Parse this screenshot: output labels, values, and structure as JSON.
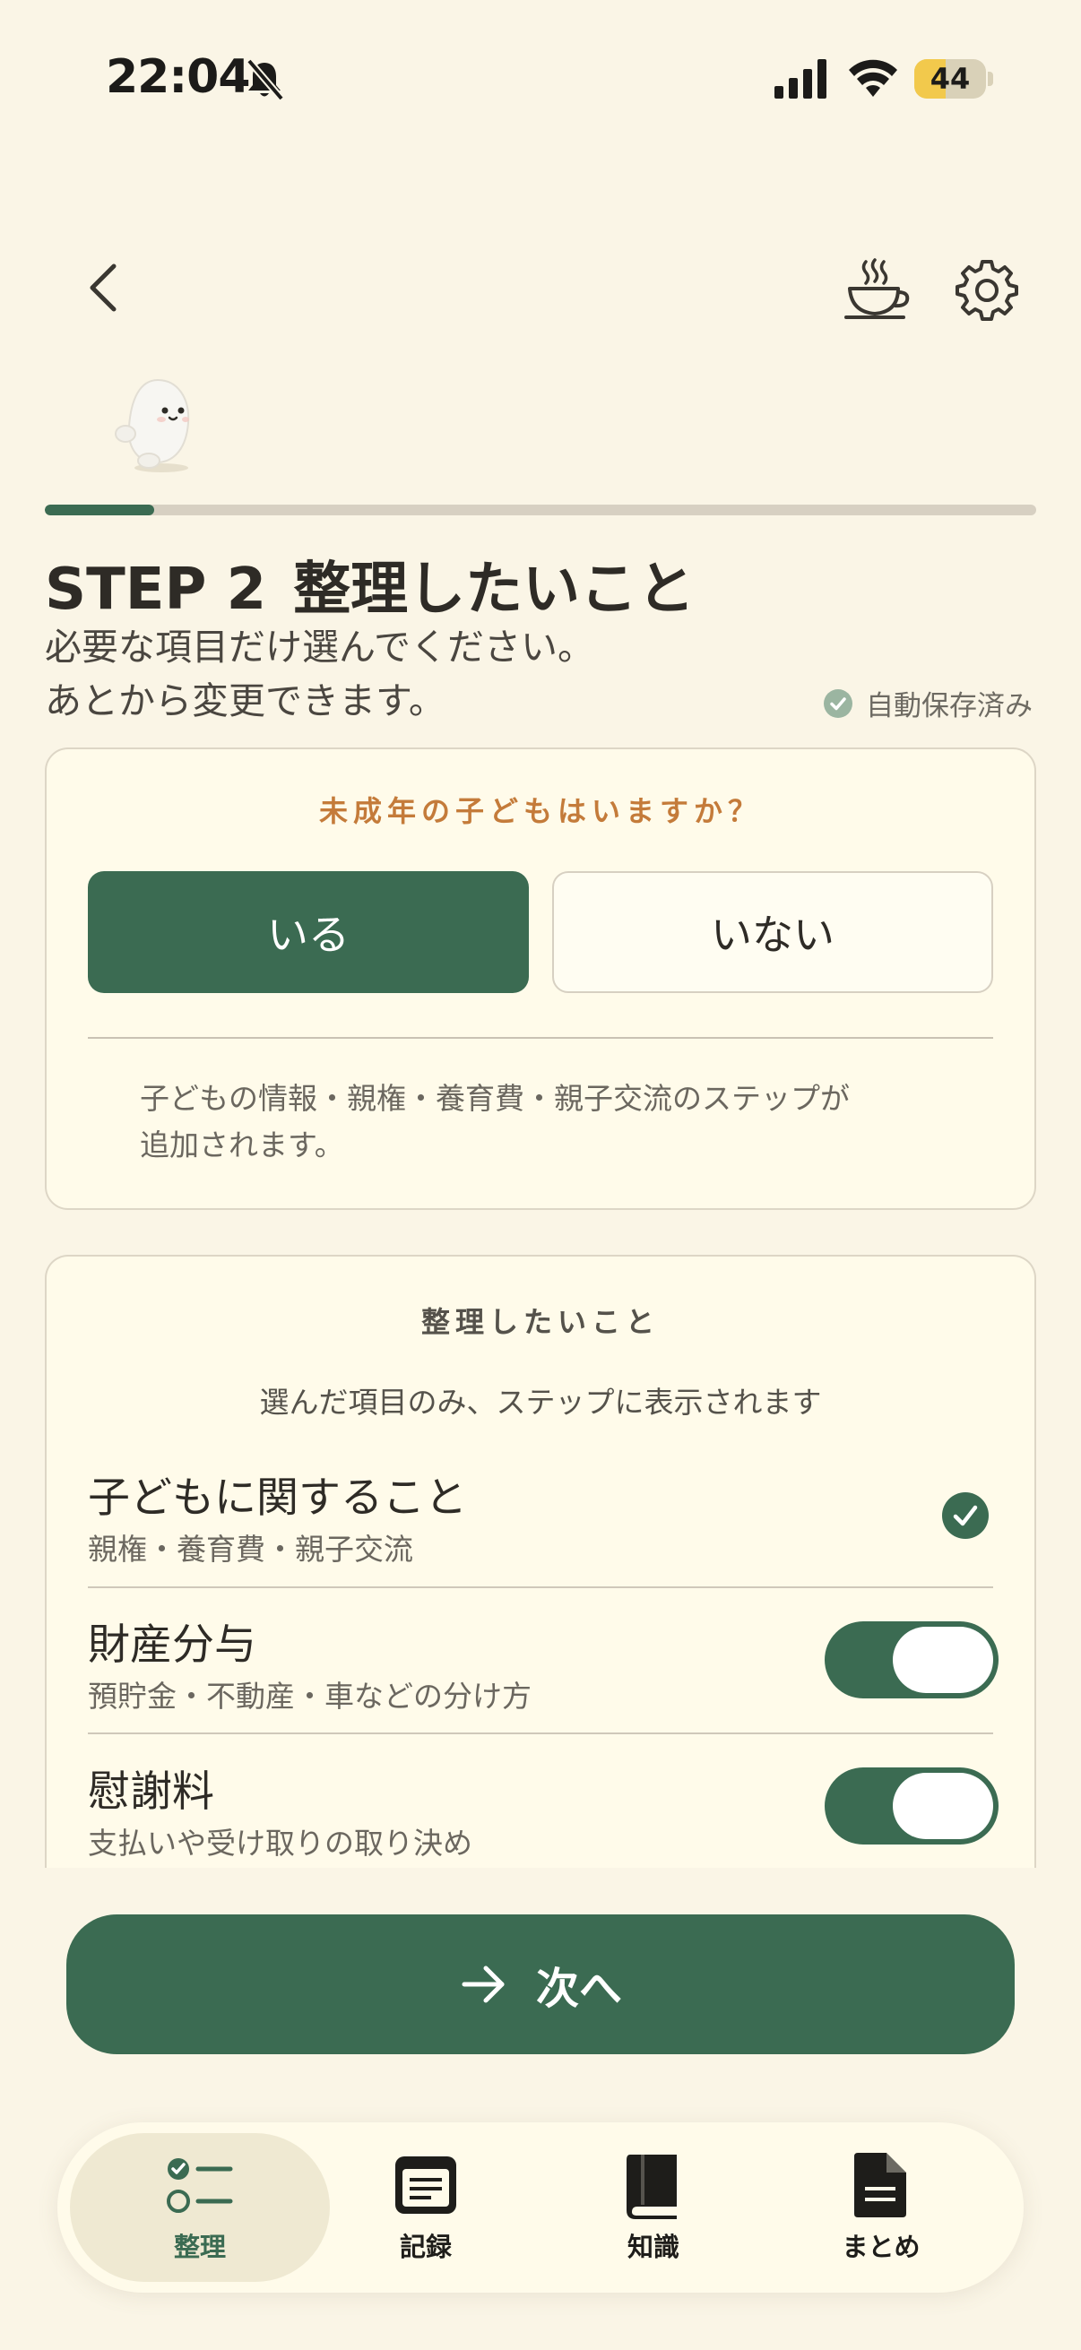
{
  "status_bar": {
    "time": "22:04",
    "battery": "44",
    "battery_level": 0.44,
    "icons": [
      "bell-slash-icon",
      "cellular-signal-icon",
      "wifi-icon",
      "battery-icon"
    ]
  },
  "header": {
    "icons": [
      "chevron-left-icon",
      "tea-cup-icon",
      "gear-icon"
    ]
  },
  "progress": {
    "value": 0.11
  },
  "step": {
    "number": "STEP 2",
    "title": "整理したいこと",
    "subtitle_line1": "必要な項目だけ選んでください。",
    "subtitle_line2": "あとから変更できます。",
    "autosave": "自動保存済み"
  },
  "children_card": {
    "question": "未成年の子どもはいますか？",
    "yes_label": "いる",
    "no_label": "いない",
    "selected": "いる",
    "note_line1": "子どもの情報・親権・養育費・親子交流のステップが",
    "note_line2": "追加されます。"
  },
  "topics_card": {
    "title": "整理したいこと",
    "subtitle": "選んだ項目のみ、ステップに表示されます",
    "items": [
      {
        "title": "子どもに関すること",
        "subtitle": "親権・養育費・親子交流",
        "control": "check",
        "on": true
      },
      {
        "title": "財産分与",
        "subtitle": "預貯金・不動産・車などの分け方",
        "control": "toggle",
        "on": true
      },
      {
        "title": "慰謝料",
        "subtitle": "支払いや受け取りの取り決め",
        "control": "toggle",
        "on": true
      }
    ]
  },
  "next_button": {
    "label": "次へ"
  },
  "colors": {
    "background": "#faf5e6",
    "accent_green": "#3b6b52",
    "question_orange": "#c47b3a",
    "card": "#fffbea"
  },
  "tabbar": {
    "tabs": [
      {
        "label": "整理",
        "icon": "checklist-icon",
        "active": true
      },
      {
        "label": "記録",
        "icon": "notes-icon",
        "active": false
      },
      {
        "label": "知識",
        "icon": "book-icon",
        "active": false
      },
      {
        "label": "まとめ",
        "icon": "document-icon",
        "active": false
      }
    ]
  }
}
